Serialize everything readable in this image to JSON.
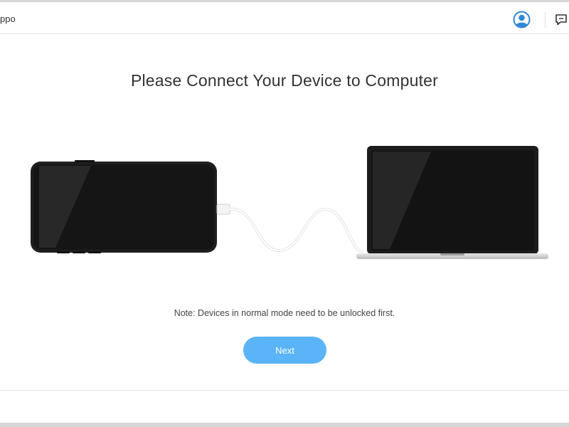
{
  "header": {
    "app_title": "ppo",
    "account_icon": "user-circle-icon",
    "feedback_icon": "chat-bubble-icon"
  },
  "main": {
    "title": "Please Connect Your Device to Computer",
    "note": "Note: Devices in normal mode need to be unlocked first.",
    "next_label": "Next"
  },
  "colors": {
    "accent": "#5ab4f7",
    "account_icon": "#2f86d6",
    "device_body": "#1e1e1e",
    "cable": "#f2f2f2"
  }
}
